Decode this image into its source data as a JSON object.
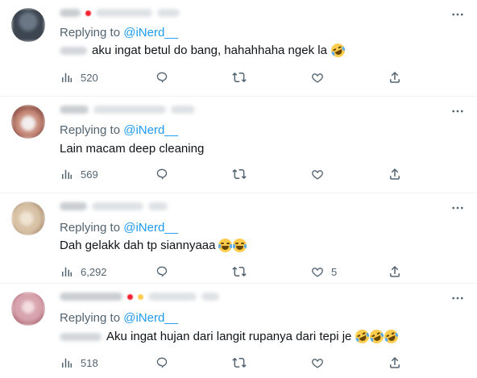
{
  "replies": [
    {
      "replying_prefix": "Replying to",
      "replying_handle": "@iNerd__",
      "text": "aku ingat betul do bang, hahahhaha ngek la",
      "emojis": [
        "rofl"
      ],
      "views": "520",
      "replies_count": "",
      "retweets_count": "",
      "likes_count": "",
      "avatar_color": "#3c4550"
    },
    {
      "replying_prefix": "Replying to",
      "replying_handle": "@iNerd__",
      "text": "Lain macam deep cleaning",
      "emojis": [],
      "views": "569",
      "replies_count": "",
      "retweets_count": "",
      "likes_count": "",
      "avatar_color": "#c78a7a"
    },
    {
      "replying_prefix": "Replying to",
      "replying_handle": "@iNerd__",
      "text": "Dah gelakk dah tp siannyaaa",
      "emojis": [
        "joy",
        "joy"
      ],
      "views": "6,292",
      "replies_count": "",
      "retweets_count": "",
      "likes_count": "5",
      "avatar_color": "#d8c2a6"
    },
    {
      "replying_prefix": "Replying to",
      "replying_handle": "@iNerd__",
      "text": "Aku ingat hujan dari langit rupanya dari tepi je",
      "emojis": [
        "rofl",
        "rofl",
        "rofl"
      ],
      "views": "518",
      "replies_count": "",
      "retweets_count": "",
      "likes_count": "",
      "avatar_color": "#d7a3ad"
    }
  ],
  "colors": {
    "link": "#1d9bf0",
    "secondary_text": "#536471",
    "divider": "#eff3f4"
  },
  "icons": {
    "views": "bar-chart-icon",
    "reply": "reply-bubble-icon",
    "retweet": "retweet-icon",
    "like": "heart-icon",
    "share": "share-icon",
    "more": "more-dots-icon"
  }
}
